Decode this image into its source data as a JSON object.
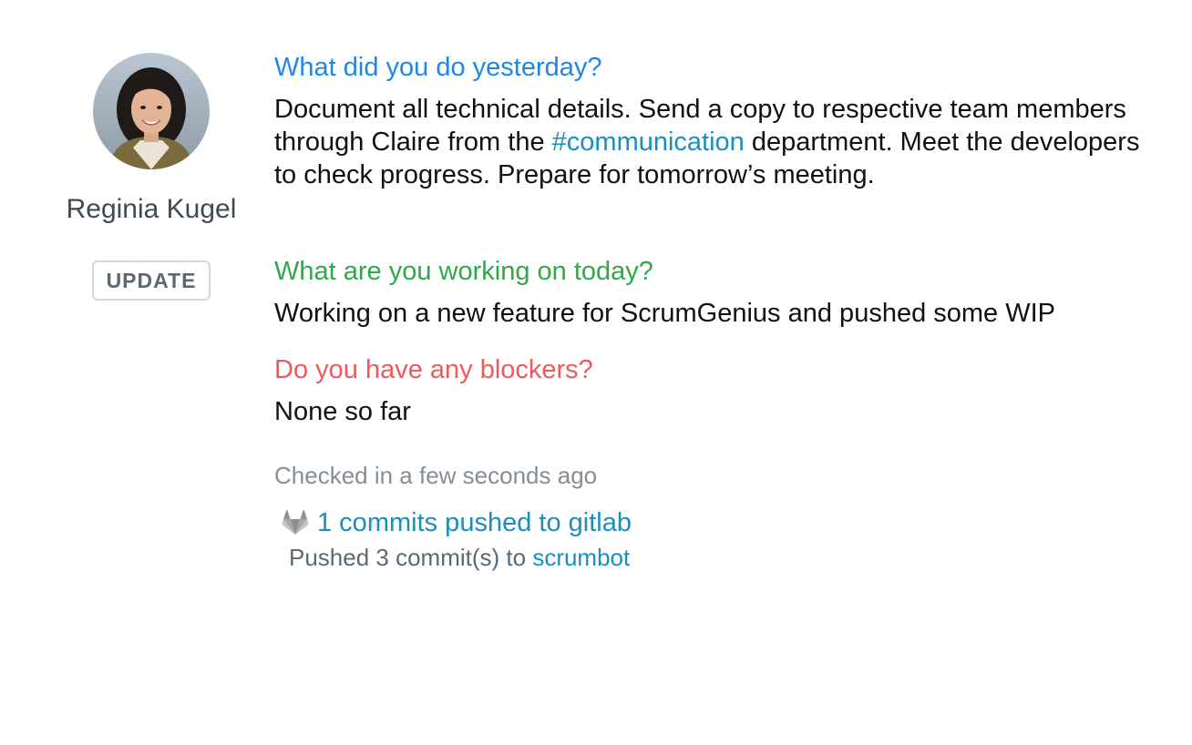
{
  "user": {
    "name": "Reginia Kugel",
    "update_label": "UPDATE"
  },
  "standup": {
    "yesterday": {
      "question": "What did you do yesterday?",
      "answer_part1": "Document all technical details. Send a copy to respective team members through Claire from the ",
      "channel_link": "#communication",
      "answer_part2": " department. Meet the developers to check progress. Prepare for tomorrow’s meeting."
    },
    "today": {
      "question": "What are you working on today?",
      "answer": "Working on a new feature for ScrumGenius and pushed some WIP"
    },
    "blockers": {
      "question": "Do you have any blockers?",
      "answer": "None so far"
    }
  },
  "checkin": {
    "text": "Checked in a few seconds ago"
  },
  "commits": {
    "icon": "gitlab-icon",
    "link_text": "1 commits pushed to gitlab",
    "detail_prefix": "Pushed 3 commit(s) to ",
    "repo_link": "scrumbot"
  },
  "colors": {
    "yesterday": "#1d89e4",
    "today": "#30a84a",
    "blockers": "#ee5a5d",
    "link": "#1a8fbf"
  }
}
